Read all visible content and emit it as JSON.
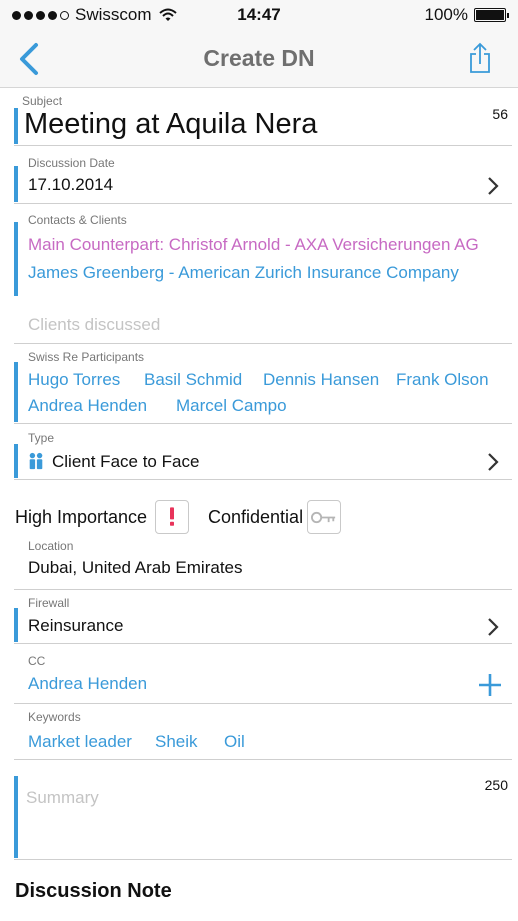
{
  "status_bar": {
    "carrier": "Swisscom",
    "time": "14:47",
    "battery": "100%"
  },
  "nav": {
    "title": "Create DN",
    "back_icon": "chevron-left-icon",
    "share_icon": "share-icon"
  },
  "subject": {
    "label": "Subject",
    "value": "Meeting at Aquila Nera",
    "counter": "56"
  },
  "discussion_date": {
    "label": "Discussion Date",
    "value": "17.10.2014"
  },
  "contacts": {
    "label": "Contacts & Clients",
    "main_counterpart": "Main Counterpart: Christof Arnold - AXA Versicherungen AG",
    "contact_2": "James Greenberg - American Zurich Insurance Company",
    "clients_placeholder": "Clients discussed"
  },
  "participants": {
    "label": "Swiss Re Participants",
    "names": [
      "Hugo Torres",
      "Basil Schmid",
      "Dennis Hansen",
      "Frank Olson",
      "Andrea Henden",
      "Marcel Campo"
    ]
  },
  "type": {
    "label": "Type",
    "value": "Client Face to Face",
    "icon": "people-icon"
  },
  "flags": {
    "high_importance": "High Importance",
    "confidential": "Confidential",
    "importance_icon": "exclamation-icon",
    "confidential_icon": "key-icon"
  },
  "location": {
    "label": "Location",
    "value": "Dubai, United Arab Emirates"
  },
  "firewall": {
    "label": "Firewall",
    "value": "Reinsurance"
  },
  "cc": {
    "label": "CC",
    "value": "Andrea Henden",
    "add_icon": "plus-icon"
  },
  "keywords": {
    "label": "Keywords",
    "items": [
      "Market leader",
      "Sheik",
      "Oil"
    ]
  },
  "summary": {
    "placeholder": "Summary",
    "counter": "250"
  },
  "discussion_note": {
    "heading": "Discussion Note"
  },
  "colors": {
    "accent": "#3a9ad9",
    "counterpart": "#c76ac3",
    "importance": "#e8335a"
  }
}
